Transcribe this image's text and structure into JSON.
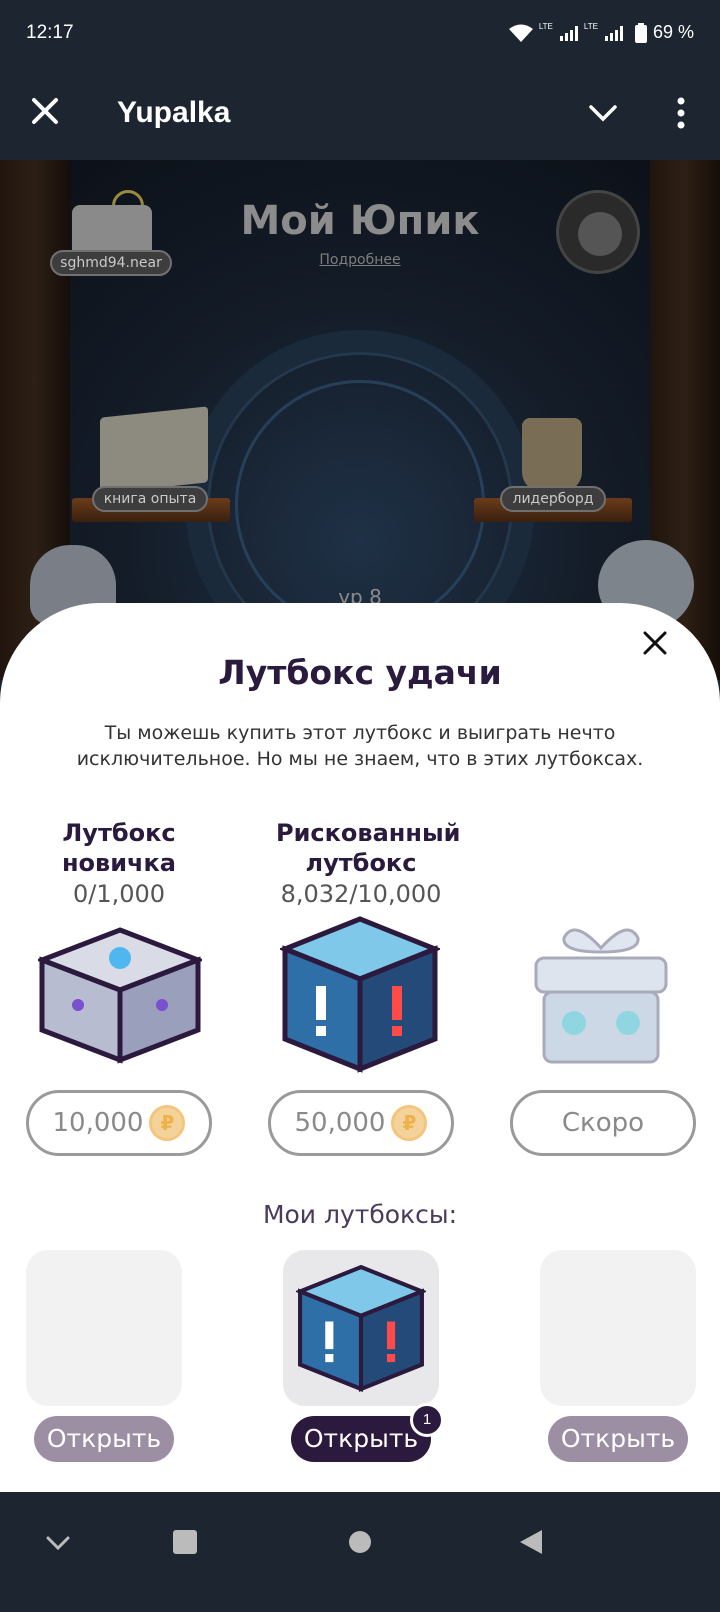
{
  "status": {
    "time": "12:17",
    "battery": "69 %",
    "network_1": "LTE",
    "network_2": "LTE"
  },
  "app_bar": {
    "title": "Yupalka",
    "close_icon": "close-icon",
    "chevron_icon": "chevron-down-icon",
    "more_icon": "more-vertical-icon"
  },
  "game": {
    "title": "Мой Юпик",
    "details_link": "Подробнее",
    "wallet_label": "sghmd94.near",
    "book_label": "книга опыта",
    "leaderboard_label": "лидерборд",
    "level_label": "ур 8"
  },
  "sheet": {
    "title": "Лутбокс удачи",
    "description": "Ты можешь купить этот лутбокс и выиграть нечто исключительное. Но мы не знаем, что в этих лутбоксах.",
    "boxes": [
      {
        "name": "Лутбокс новичка",
        "count": "0/1,000",
        "price": "10,000"
      },
      {
        "name": "Рискованный лутбокс",
        "count": "8,032/10,000",
        "price": "50,000"
      },
      {
        "name": "",
        "count": "",
        "price": "Скоро"
      }
    ],
    "my_title": "Мои лутбоксы:",
    "open_label": "Открыть",
    "badge_count": "1"
  },
  "colors": {
    "accent": "#2b1a3d",
    "inactive_button": "#9c8fa3",
    "coin": "#f3d39b"
  }
}
